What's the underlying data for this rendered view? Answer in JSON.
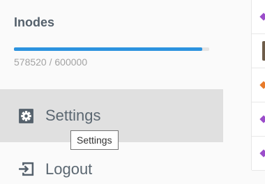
{
  "sidebar": {
    "inodes": {
      "title": "Inodes",
      "used": 578520,
      "total": 600000,
      "usage_text": "578520 / 600000",
      "progress_fraction": 0.964,
      "bar_color": "#2c93df"
    },
    "settings": {
      "label": "Settings",
      "icon": "gear-icon",
      "tooltip": "Settings"
    },
    "logout": {
      "label": "Logout",
      "icon": "logout-icon"
    }
  },
  "right_strip": {
    "markers": [
      {
        "color": "#9b4dca",
        "icon": "diamond-icon"
      },
      {
        "color": "#6e5d4a",
        "icon": "thumbnail"
      },
      {
        "color": "#e87b2a",
        "icon": "diamond-icon"
      },
      {
        "color": "#9b4dca",
        "icon": "diamond-icon"
      },
      {
        "color": "#9b4dca",
        "icon": "diamond-icon"
      }
    ]
  }
}
